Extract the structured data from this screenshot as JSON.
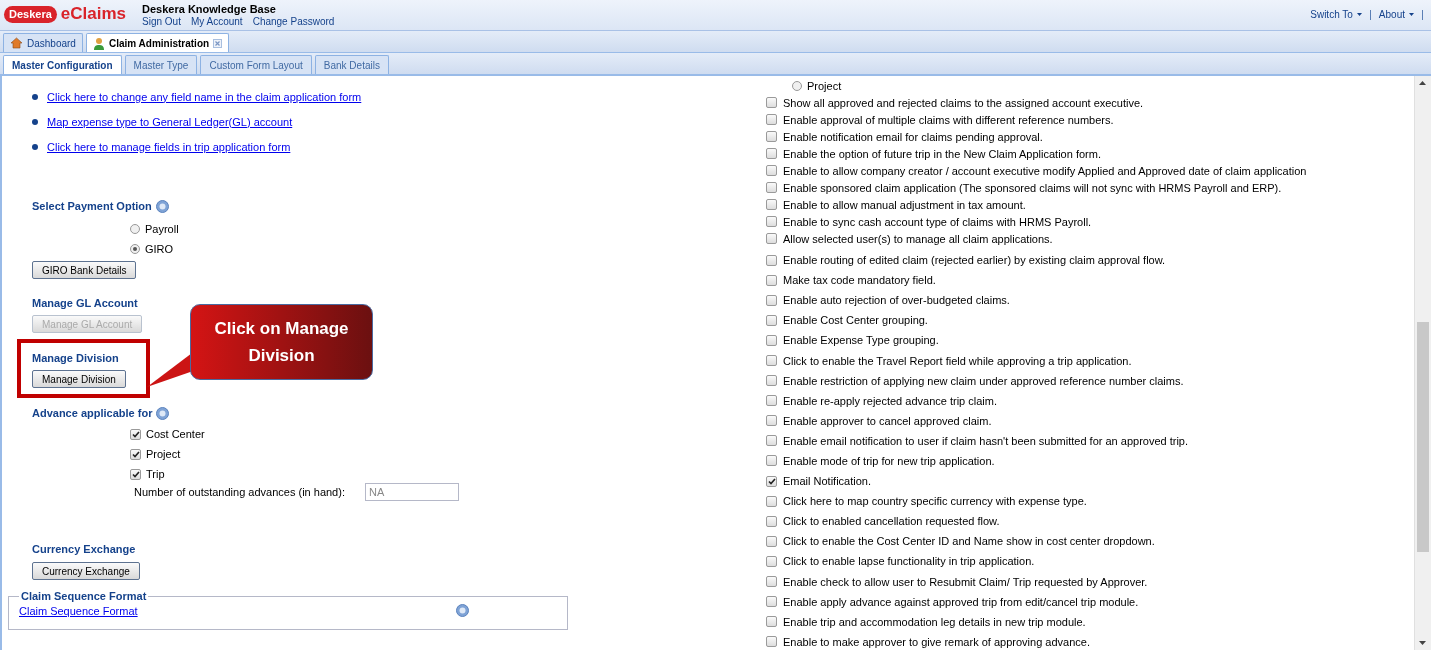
{
  "header": {
    "logo_brand": "Deskera",
    "logo_product": "eClaims",
    "site_title": "Deskera Knowledge Base",
    "user_links": [
      "Sign Out",
      "My Account",
      "Change Password"
    ],
    "menus": [
      "Switch To",
      "About"
    ]
  },
  "tabs": [
    {
      "label": "Dashboard",
      "selected": false,
      "closable": false
    },
    {
      "label": "Claim Administration",
      "selected": true,
      "closable": true
    }
  ],
  "subtabs": [
    {
      "label": "Master Configuration",
      "selected": true
    },
    {
      "label": "Master Type",
      "selected": false
    },
    {
      "label": "Custom Form Layout",
      "selected": false
    },
    {
      "label": "Bank Details",
      "selected": false
    }
  ],
  "left": {
    "links": [
      "Click here to change any field name in the claim application form",
      "Map expense type to General Ledger(GL) account",
      "Click here to manage fields in trip application form"
    ],
    "payment": {
      "title": "Select Payment Option",
      "options": [
        {
          "label": "Payroll",
          "selected": false
        },
        {
          "label": "GIRO",
          "selected": true
        }
      ],
      "button": "GIRO Bank Details"
    },
    "gl": {
      "title": "Manage GL Account",
      "button": "Manage GL Account",
      "disabled": true
    },
    "division": {
      "title": "Manage Division",
      "button": "Manage Division",
      "highlighted": true
    },
    "advance": {
      "title": "Advance applicable for",
      "options": [
        {
          "label": "Cost Center",
          "checked": true
        },
        {
          "label": "Project",
          "checked": true
        },
        {
          "label": "Trip",
          "checked": true
        }
      ],
      "outstanding_label": "Number of outstanding advances (in hand):",
      "outstanding_value": "NA"
    },
    "currency": {
      "title": "Currency Exchange",
      "button": "Currency Exchange"
    },
    "sequence": {
      "legend": "Claim Sequence Format",
      "link": "Claim Sequence Format"
    }
  },
  "callout": {
    "text": "Click on Manage Division"
  },
  "right": {
    "radio": {
      "label": "Project",
      "selected": false
    },
    "options": [
      {
        "label": "Show all approved and rejected claims to the assigned account executive.",
        "checked": false
      },
      {
        "label": "Enable approval of multiple claims with different reference numbers.",
        "checked": false
      },
      {
        "label": "Enable notification email for claims pending approval.",
        "checked": false
      },
      {
        "label": "Enable the option of future trip in the New Claim Application form.",
        "checked": false
      },
      {
        "label": "Enable to allow company creator / account executive modify Applied and Approved date of claim application",
        "checked": false
      },
      {
        "label": "Enable sponsored claim application (The sponsored claims will not sync with HRMS Payroll and ERP).",
        "checked": false
      },
      {
        "label": "Enable to allow manual adjustment in tax amount.",
        "checked": false
      },
      {
        "label": "Enable to sync cash account type of claims with HRMS Payroll.",
        "checked": false
      },
      {
        "label": "Allow selected user(s) to manage all claim applications.",
        "checked": false
      },
      {
        "label": "Enable routing of edited claim (rejected earlier) by existing claim approval flow.",
        "checked": false
      },
      {
        "label": "Make tax code mandatory field.",
        "checked": false
      },
      {
        "label": "Enable auto rejection of over-budgeted claims.",
        "checked": false
      },
      {
        "label": "Enable Cost Center grouping.",
        "checked": false
      },
      {
        "label": "Enable Expense Type grouping.",
        "checked": false
      },
      {
        "label": "Click to enable the Travel Report field while approving a trip application.",
        "checked": false
      },
      {
        "label": "Enable restriction of applying new claim under approved reference number claims.",
        "checked": false
      },
      {
        "label": "Enable re-apply rejected advance trip claim.",
        "checked": false
      },
      {
        "label": "Enable approver to cancel approved claim.",
        "checked": false
      },
      {
        "label": "Enable email notification to user if claim hasn't been submitted for an approved trip.",
        "checked": false
      },
      {
        "label": "Enable mode of trip for new trip application.",
        "checked": false
      },
      {
        "label": "Email Notification.",
        "checked": true
      },
      {
        "label": "Click here to map country specific currency with expense type.",
        "checked": false
      },
      {
        "label": "Click to enabled cancellation requested flow.",
        "checked": false
      },
      {
        "label": "Click to enable the Cost Center ID and Name show in cost center dropdown.",
        "checked": false
      },
      {
        "label": "Click to enable lapse functionality in trip application.",
        "checked": false
      },
      {
        "label": "Enable check to allow user to Resubmit Claim/ Trip requested by Approver.",
        "checked": false
      },
      {
        "label": "Enable apply advance against approved trip from edit/cancel trip module.",
        "checked": false
      },
      {
        "label": "Enable trip and accommodation leg details in new trip module.",
        "checked": false
      },
      {
        "label": "Enable to make approver to give remark of approving advance.",
        "checked": false
      }
    ]
  }
}
